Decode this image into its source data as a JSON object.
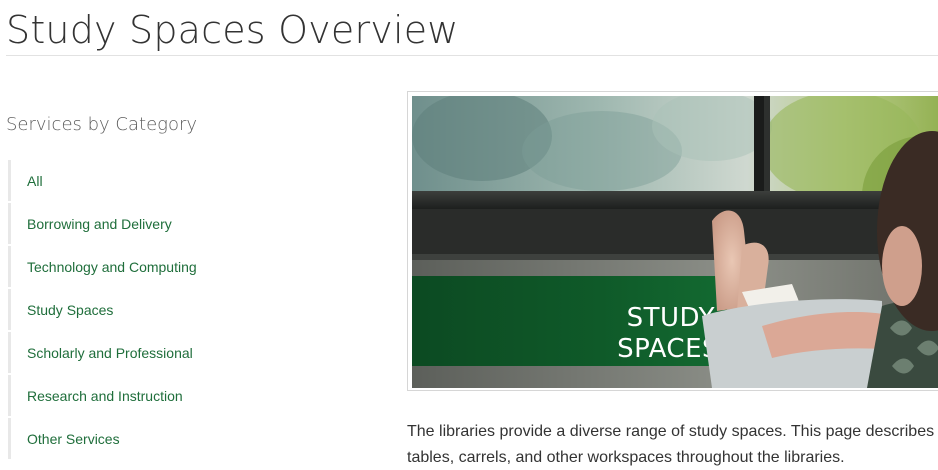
{
  "page": {
    "title": "Study Spaces Overview"
  },
  "sidebar": {
    "heading": "Services by Category",
    "items": [
      {
        "label": "All"
      },
      {
        "label": "Borrowing and Delivery"
      },
      {
        "label": "Technology and Computing"
      },
      {
        "label": "Study Spaces"
      },
      {
        "label": "Scholarly and Professional"
      },
      {
        "label": "Research and Instruction"
      },
      {
        "label": "Other Services"
      }
    ]
  },
  "hero": {
    "caption_line1": "STUDY",
    "caption_line2": "SPACES"
  },
  "main": {
    "intro": "The libraries provide a diverse range of study spaces. This page describes tables, carrels, and other workspaces throughout the libraries."
  },
  "colors": {
    "link": "#1f6e3b",
    "banner_green": "#0e5a28",
    "text": "#333333"
  }
}
